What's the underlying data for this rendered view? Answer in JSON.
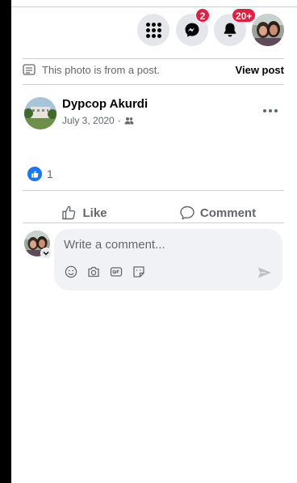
{
  "topbar": {
    "menu_label": "Menu",
    "messenger_badge": "2",
    "notifications_badge": "20+"
  },
  "post_info": {
    "text": "This photo is from a post.",
    "view_post": "View post"
  },
  "author": {
    "name": "Dypcop Akurdi",
    "date": "July 3, 2020",
    "separator": "·"
  },
  "reactions": {
    "count": "1"
  },
  "actions": {
    "like_label": "Like",
    "comment_label": "Comment"
  },
  "composer": {
    "placeholder": "Write a comment..."
  },
  "colors": {
    "accent": "#1877f2",
    "badge": "#e41e3f",
    "button_bg": "#e4e6eb",
    "secondary_text": "#65676b"
  }
}
